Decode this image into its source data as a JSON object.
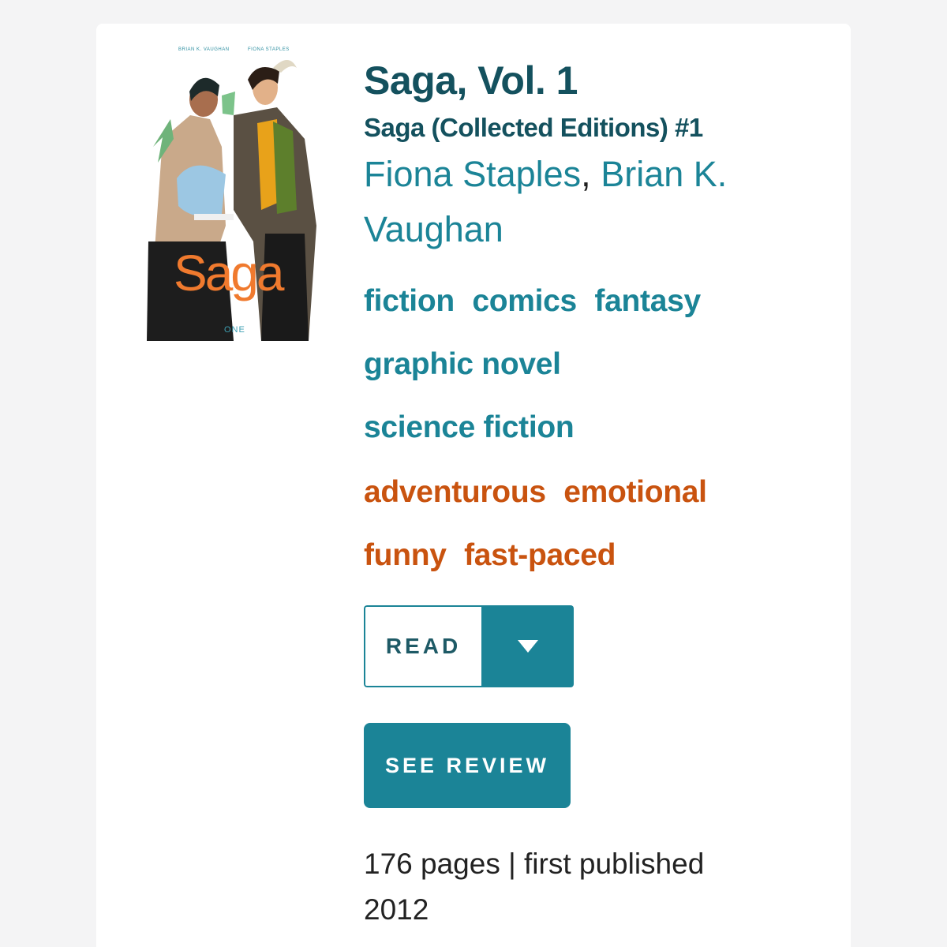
{
  "cover": {
    "author_left": "BRIAN K. VAUGHAN",
    "author_right": "FIONA STAPLES",
    "title": "Saga",
    "volume": "ONE"
  },
  "book": {
    "title": "Saga, Vol. 1",
    "series": "Saga (Collected Editions) #1",
    "authors": [
      "Fiona Staples",
      "Brian K. Vaughan"
    ],
    "author_separator": ","
  },
  "tags": {
    "genres": [
      "fiction",
      "comics",
      "fantasy",
      "graphic novel",
      "science fiction"
    ],
    "moods": [
      "adventurous",
      "emotional",
      "funny",
      "fast-paced"
    ]
  },
  "actions": {
    "read_status": "READ",
    "dropdown_icon": "caret-down-icon",
    "see_review": "SEE REVIEW"
  },
  "meta": {
    "pages_text": "176 pages | first published 2012"
  },
  "colors": {
    "teal": "#1b8497",
    "dark_teal": "#14515e",
    "orange": "#c9530f",
    "cover_orange": "#f07a2e"
  }
}
